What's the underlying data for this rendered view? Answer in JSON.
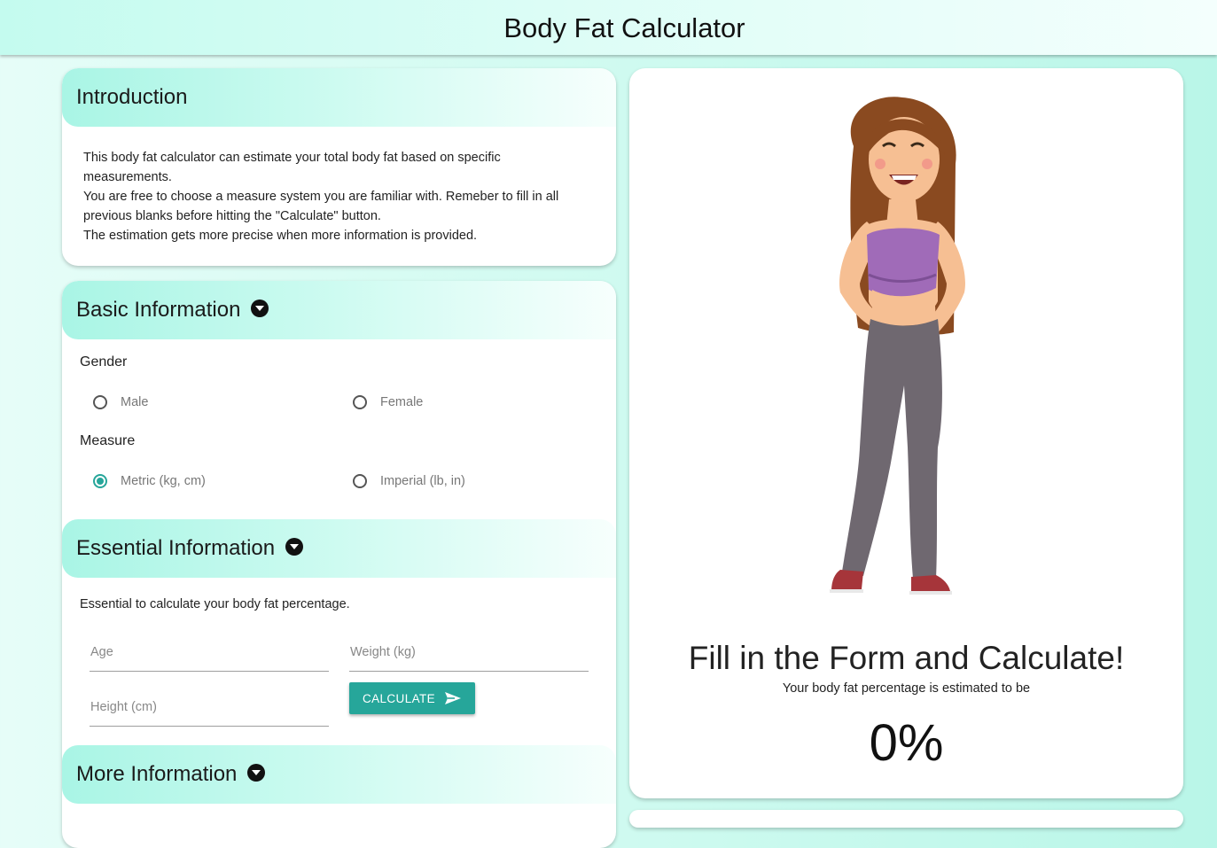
{
  "header": {
    "title": "Body Fat Calculator"
  },
  "introduction": {
    "title": "Introduction",
    "paragraphs": [
      "This body fat calculator can estimate your total body fat based on specific measurements.",
      "You are free to choose a measure system you are familiar with. Remeber to fill in all previous blanks before hitting the \"Calculate\" button.",
      "The estimation gets more precise when more information is provided."
    ]
  },
  "basic": {
    "title": "Basic Information",
    "gender_label": "Gender",
    "gender_options": [
      "Male",
      "Female"
    ],
    "gender_selected": null,
    "measure_label": "Measure",
    "measure_options": [
      "Metric (kg, cm)",
      "Imperial (lb, in)"
    ],
    "measure_selected": "Metric (kg, cm)"
  },
  "essential": {
    "title": "Essential Information",
    "description": "Essential to calculate your body fat percentage.",
    "age_placeholder": "Age",
    "weight_placeholder": "Weight (kg)",
    "height_placeholder": "Height (cm)",
    "calculate_label": "CALCULATE"
  },
  "more": {
    "title": "More Information"
  },
  "result": {
    "title": "Fill in the Form and Calculate!",
    "subtitle": "Your body fat percentage is estimated to be",
    "value": "0%"
  },
  "colors": {
    "accent": "#26a69a",
    "header_gradient_start": "#a9f5e5"
  },
  "icons": {
    "section_toggle": "caret-down-circle-icon",
    "calculate": "send-icon"
  }
}
